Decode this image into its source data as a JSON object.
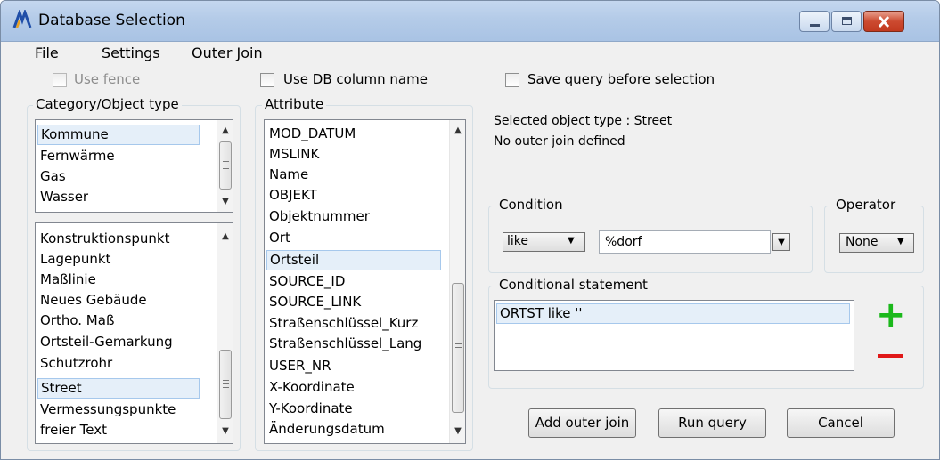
{
  "window": {
    "title": "Database Selection"
  },
  "menu": [
    "File",
    "Settings",
    "Outer Join"
  ],
  "checkboxes": {
    "use_fence": "Use fence",
    "use_db_column_name": "Use DB column name",
    "save_query": "Save query before selection"
  },
  "category": {
    "label": "Category/Object type",
    "top_list": [
      "Kommune",
      "Fernwärme",
      "Gas",
      "Wasser"
    ],
    "top_selected": "Kommune",
    "bottom_list": [
      "Konstruktionspunkt",
      "Lagepunkt",
      "Maßlinie",
      "Neues Gebäude",
      "Ortho. Maß",
      "Ortsteil-Gemarkung",
      "Schutzrohr",
      "Street",
      "Vermessungspunkte",
      "freier Text"
    ],
    "bottom_selected": "Street"
  },
  "attribute": {
    "label": "Attribute",
    "items": [
      "MOD_DATUM",
      "MSLINK",
      "Name",
      "OBJEKT",
      "Objektnummer",
      "Ort",
      "Ortsteil",
      "SOURCE_ID",
      "SOURCE_LINK",
      "Straßenschlüssel_Kurz",
      "Straßenschlüssel_Lang",
      "USER_NR",
      "X-Koordinate",
      "Y-Koordinate",
      "Änderungsdatum"
    ],
    "selected": "Ortsteil"
  },
  "info": {
    "selected_object_type": "Selected object type : Street",
    "outer_join": "No outer join defined"
  },
  "condition": {
    "label": "Condition",
    "operator_value": "like",
    "value": "%dorf"
  },
  "operator": {
    "label": "Operator",
    "value": "None"
  },
  "conditional_statement": {
    "label": "Conditional statement",
    "items": [
      "ORTST like ''"
    ]
  },
  "buttons": {
    "add_outer_join": "Add outer join",
    "run_query": "Run query",
    "cancel": "Cancel"
  },
  "colors": {
    "plus": "#1bb81b",
    "minus": "#e01818",
    "selection": "#e5eff9"
  }
}
